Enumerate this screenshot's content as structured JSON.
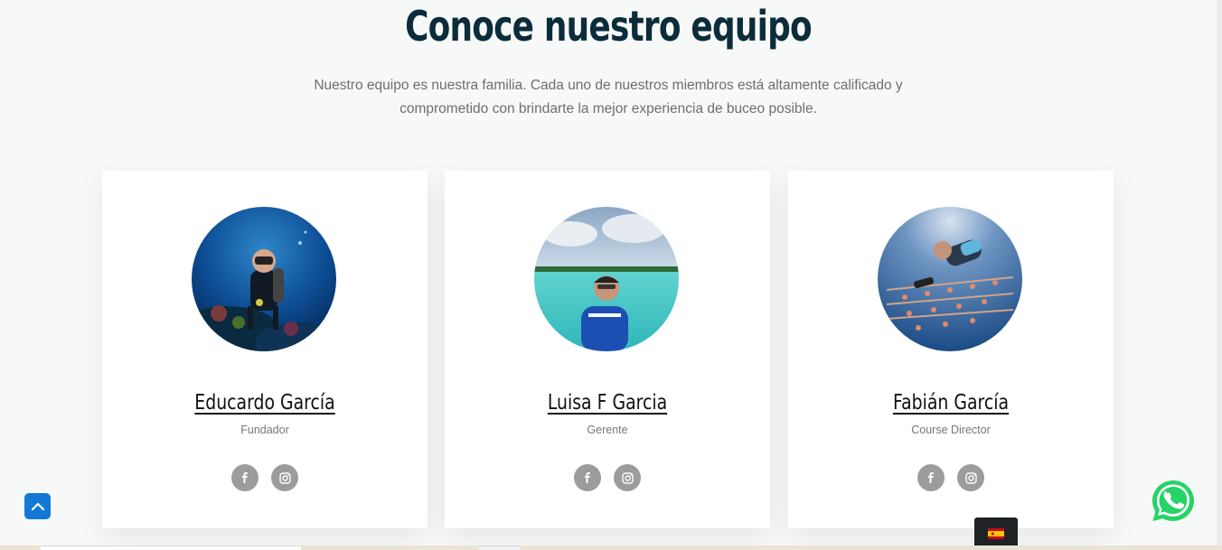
{
  "section": {
    "title": "Conoce nuestro equipo",
    "subtitle_line1": "Nuestro equipo es nuestra familia. Cada uno de nuestros miembros está altamente calificado y",
    "subtitle_line2": "comprometido con brindarte la mejor experiencia de buceo posible."
  },
  "team": [
    {
      "name": "Educardo García",
      "role": "Fundador",
      "photo_icon": "diver-underwater-photo",
      "social": [
        "facebook-icon",
        "instagram-icon"
      ]
    },
    {
      "name": "Luisa F Garcia",
      "role": "Gerente",
      "photo_icon": "beach-portrait-photo",
      "social": [
        "facebook-icon",
        "instagram-icon"
      ]
    },
    {
      "name": "Fabián García",
      "role": "Course Director",
      "photo_icon": "coral-nursery-diver-photo",
      "social": [
        "facebook-icon",
        "instagram-icon"
      ]
    }
  ],
  "widgets": {
    "scroll_top_icon": "chevron-up-icon",
    "whatsapp_icon": "whatsapp-icon",
    "language_flag": "spain-flag-icon"
  },
  "colors": {
    "background": "#f7f8f8",
    "heading": "#0b2c3a",
    "social_button": "#9c9c9c",
    "scroll_top": "#1479d6",
    "whatsapp": "#25d366",
    "lang_switcher": "#1f2326"
  }
}
